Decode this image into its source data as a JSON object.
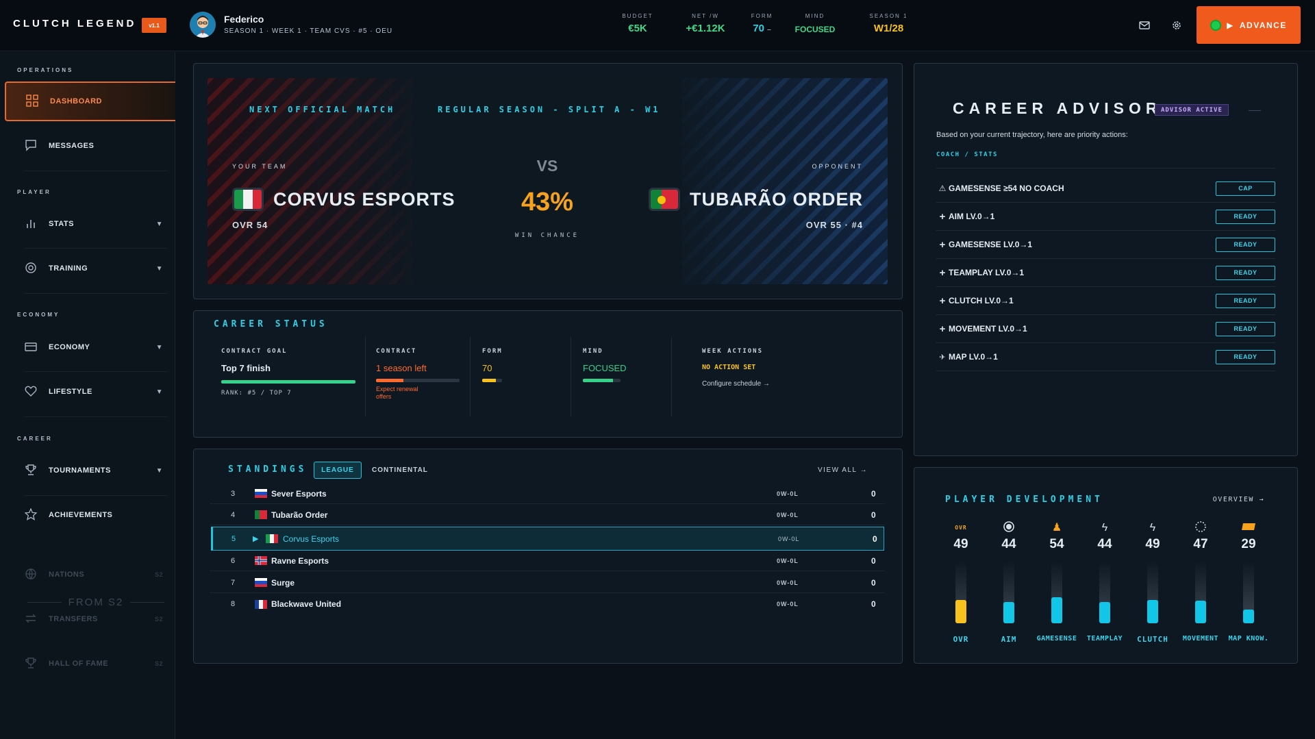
{
  "app": {
    "logo": "CLUTCH LEGEND",
    "version": "v1.1"
  },
  "player": {
    "name": "Federico",
    "subtitle": "SEASON 1 · WEEK 1 · TEAM CVS · #5 · OEU"
  },
  "header_stats": [
    {
      "label": "BUDGET",
      "value": "€5K",
      "color": "#3fd98a"
    },
    {
      "label": "NET /W",
      "value": "+€1.12K",
      "color": "#3fd98a"
    },
    {
      "label": "FORM",
      "value": "70",
      "suffix": "–",
      "color": "#2bd0e6"
    },
    {
      "label": "MIND",
      "value": "FOCUSED",
      "color": "#3fd98a"
    },
    {
      "label": "SEASON 1",
      "value": "W1/28",
      "color": "#f7c21e"
    }
  ],
  "advance_label": "ADVANCE",
  "sidebar": {
    "sections": {
      "operations": "OPERATIONS",
      "player": "PLAYER",
      "economy": "ECONOMY",
      "career": "CAREER"
    },
    "items": {
      "dashboard": "DASHBOARD",
      "messages": "MESSAGES",
      "stats": "STATS",
      "training": "TRAINING",
      "economy": "ECONOMY",
      "lifestyle": "LIFESTYLE",
      "tournaments": "TOURNAMENTS",
      "achievements": "ACHIEVEMENTS",
      "nations": "NATIONS",
      "transfers": "TRANSFERS",
      "hall_of_fame": "HALL OF FAME"
    },
    "from_s2": "FROM S2",
    "s2_tag": "S2"
  },
  "match": {
    "heading": "NEXT OFFICIAL MATCH",
    "competition": "REGULAR SEASON - SPLIT A - W1",
    "your_team_label": "YOUR TEAM",
    "your_team": "CORVUS ESPORTS",
    "your_ovr": "OVR 54",
    "vs": "VS",
    "win_chance": "43%",
    "win_chance_label": "WIN CHANCE",
    "opponent_label": "OPPONENT",
    "opponent": "TUBARÃO ORDER",
    "opponent_info": "OVR 55 · #4"
  },
  "career_status": {
    "title": "CAREER STATUS",
    "contract_goal": {
      "label": "CONTRACT GOAL",
      "value": "Top 7 finish",
      "progress": 1.0,
      "sub": "RANK: #5 / TOP 7"
    },
    "contract": {
      "label": "CONTRACT",
      "value": "1 season left",
      "progress": 0.33,
      "note": "Expect renewal offers"
    },
    "form": {
      "label": "FORM",
      "value": "70",
      "progress": 0.7
    },
    "mind": {
      "label": "MIND",
      "value": "FOCUSED",
      "progress": 0.8
    },
    "week_actions": {
      "label": "WEEK ACTIONS",
      "value": "NO ACTION SET",
      "link": "Configure schedule →"
    }
  },
  "standings": {
    "title": "STANDINGS",
    "tabs": [
      "LEAGUE",
      "CONTINENTAL"
    ],
    "view_all": "VIEW ALL →",
    "rows": [
      {
        "rank": "3",
        "team": "Sever Esports",
        "record": "0W-0L",
        "points": "0",
        "flag": "ru"
      },
      {
        "rank": "4",
        "team": "Tubarão Order",
        "record": "0W-0L",
        "points": "0",
        "flag": "pt"
      },
      {
        "rank": "5",
        "team": "Corvus Esports",
        "record": "0W-0L",
        "points": "0",
        "flag": "it",
        "highlight": true
      },
      {
        "rank": "6",
        "team": "Ravne Esports",
        "record": "0W-0L",
        "points": "0",
        "flag": "no"
      },
      {
        "rank": "7",
        "team": "Surge",
        "record": "0W-0L",
        "points": "0",
        "flag": "ru"
      },
      {
        "rank": "8",
        "team": "Blackwave United",
        "record": "0W-0L",
        "points": "0",
        "flag": "fr"
      }
    ]
  },
  "advisor": {
    "title": "CAREER ADVISOR",
    "badge": "ADVISOR ACTIVE",
    "intro": "Based on your current trajectory, here are priority actions:",
    "filter": "COACH / STATS",
    "items": [
      {
        "icon": "warning-icon",
        "label": "GAMESENSE ≥54 NO COACH",
        "action": "CAP"
      },
      {
        "icon": "plus-icon",
        "label": "AIM LV.0→1",
        "action": "READY"
      },
      {
        "icon": "plus-icon",
        "label": "GAMESENSE LV.0→1",
        "action": "READY"
      },
      {
        "icon": "plus-icon",
        "label": "TEAMPLAY LV.0→1",
        "action": "READY"
      },
      {
        "icon": "plus-icon",
        "label": "CLUTCH LV.0→1",
        "action": "READY"
      },
      {
        "icon": "plus-icon",
        "label": "MOVEMENT LV.0→1",
        "action": "READY"
      },
      {
        "icon": "map-icon",
        "label": "MAP LV.0→1",
        "action": "READY"
      }
    ]
  },
  "development": {
    "title": "PLAYER DEVELOPMENT",
    "overview": "OVERVIEW →",
    "ovr_tag": "OVR",
    "attributes": [
      {
        "name": "OVR",
        "value": "49",
        "level": 0.49,
        "color": "#f7c21e"
      },
      {
        "name": "AIM",
        "value": "44",
        "level": 0.44,
        "color": "#12c6e8"
      },
      {
        "name": "GAMESENSE",
        "value": "54",
        "level": 0.54,
        "color": "#12c6e8"
      },
      {
        "name": "TEAMPLAY",
        "value": "44",
        "level": 0.44,
        "color": "#12c6e8"
      },
      {
        "name": "CLUTCH",
        "value": "49",
        "level": 0.49,
        "color": "#12c6e8"
      },
      {
        "name": "MOVEMENT",
        "value": "47",
        "level": 0.47,
        "color": "#12c6e8"
      },
      {
        "name": "MAP KNOW.",
        "value": "29",
        "level": 0.29,
        "color": "#12c6e8"
      }
    ]
  }
}
